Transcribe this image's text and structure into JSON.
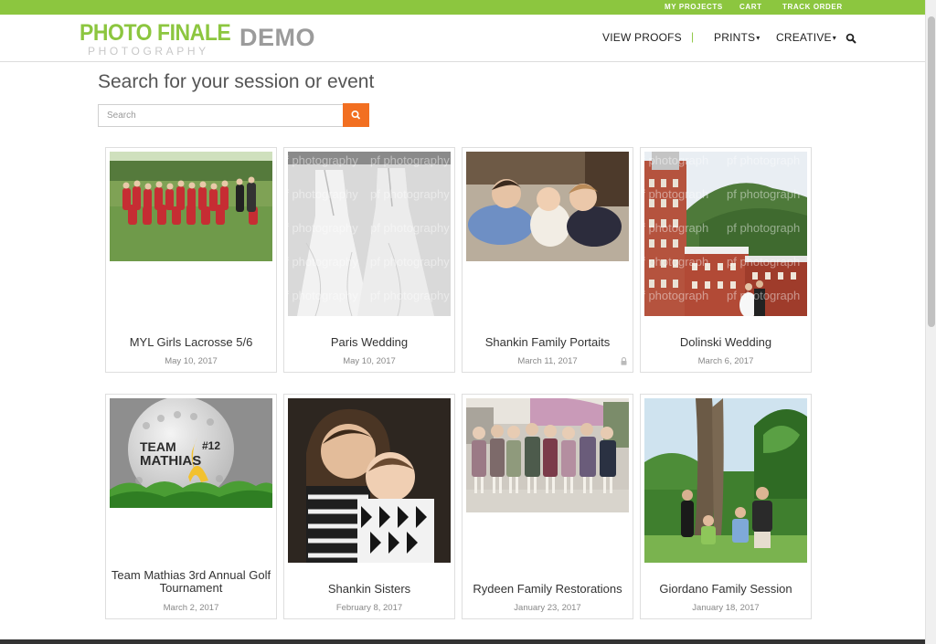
{
  "topbar": {
    "my_projects": "MY PROJECTS",
    "cart": "CART",
    "track_order": "TRACK ORDER"
  },
  "logo": {
    "line1": "PHOTO FINALE",
    "line2": "PHOTOGRAPHY",
    "demo": "DEMO"
  },
  "nav": {
    "view_proofs": "VIEW PROOFS",
    "separator": "|",
    "prints": "PRINTS",
    "creative": "CREATIVE",
    "caret": "▾"
  },
  "main": {
    "heading": "Search for your session or event",
    "search_placeholder": "Search"
  },
  "galleries": [
    {
      "title": "MYL Girls Lacrosse 5/6",
      "date": "May 10, 2017",
      "photo": "lacrosse-team"
    },
    {
      "title": "Paris Wedding",
      "date": "May 10, 2017",
      "photo": "wedding-dress",
      "watermark": "pf photography"
    },
    {
      "title": "Shankin Family Portaits",
      "date": "March 11, 2017",
      "photo": "kids-on-floor",
      "locked": true
    },
    {
      "title": "Dolinski Wedding",
      "date": "March 6, 2017",
      "photo": "hotel-wedding",
      "watermark": "pf photograph"
    },
    {
      "title": "Team Mathias 3rd Annual Golf Tournament",
      "date": "March 2, 2017",
      "photo": "golf-ball",
      "graphic_text": [
        "TEAM",
        "MATHIAS",
        "#12"
      ]
    },
    {
      "title": "Shankin Sisters",
      "date": "February 8, 2017",
      "photo": "sisters"
    },
    {
      "title": "Rydeen Family Restorations",
      "date": "January 23, 2017",
      "photo": "vintage-kids"
    },
    {
      "title": "Giordano Family Session",
      "date": "January 18, 2017",
      "photo": "family-tree"
    }
  ],
  "colors": {
    "accent_green": "#8cc63f",
    "search_orange": "#f26f21"
  }
}
